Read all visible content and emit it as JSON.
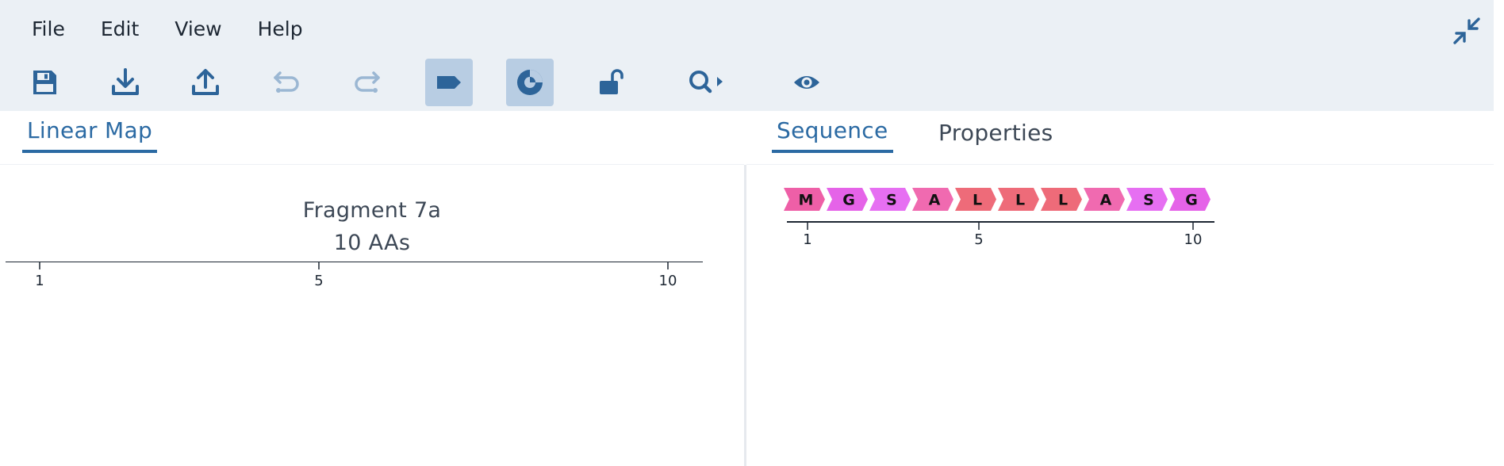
{
  "menu": {
    "file": "File",
    "edit": "Edit",
    "view": "View",
    "help": "Help"
  },
  "toolbar": {
    "buttons": [
      {
        "name": "save-icon",
        "active": false,
        "disabled": false
      },
      {
        "name": "download-icon",
        "active": false,
        "disabled": false
      },
      {
        "name": "upload-icon",
        "active": false,
        "disabled": false
      },
      {
        "name": "undo-icon",
        "active": false,
        "disabled": true
      },
      {
        "name": "redo-icon",
        "active": false,
        "disabled": true
      },
      {
        "name": "feature-label-icon",
        "active": true,
        "disabled": false
      },
      {
        "name": "circular-view-icon",
        "active": true,
        "disabled": false
      },
      {
        "name": "unlock-icon",
        "active": false,
        "disabled": false
      },
      {
        "name": "search-menu-icon",
        "active": false,
        "disabled": false
      },
      {
        "name": "eye-icon",
        "active": false,
        "disabled": false
      }
    ]
  },
  "left_pane": {
    "tab_linear_map": "Linear Map",
    "map_name": "Fragment 7a",
    "map_length": "10 AAs",
    "ruler_ticks": [
      "1",
      "5",
      "10"
    ]
  },
  "right_pane": {
    "tab_sequence": "Sequence",
    "tab_properties": "Properties",
    "residues": [
      "M",
      "G",
      "S",
      "A",
      "L",
      "L",
      "L",
      "A",
      "S",
      "G"
    ],
    "ruler_ticks": [
      "1",
      "5",
      "10"
    ]
  },
  "colors": {
    "accent": "#2b6aa3",
    "icon": "#2d6499",
    "icon_disabled": "#9bb7d3",
    "active_bg": "#b8cde3",
    "chrome_bg": "#ebf0f5",
    "residue_M": "#ee5fa7",
    "residue_G": "#e563e8",
    "residue_S": "#e66ff2",
    "residue_A": "#f06ab0",
    "residue_L": "#ee6b79"
  }
}
